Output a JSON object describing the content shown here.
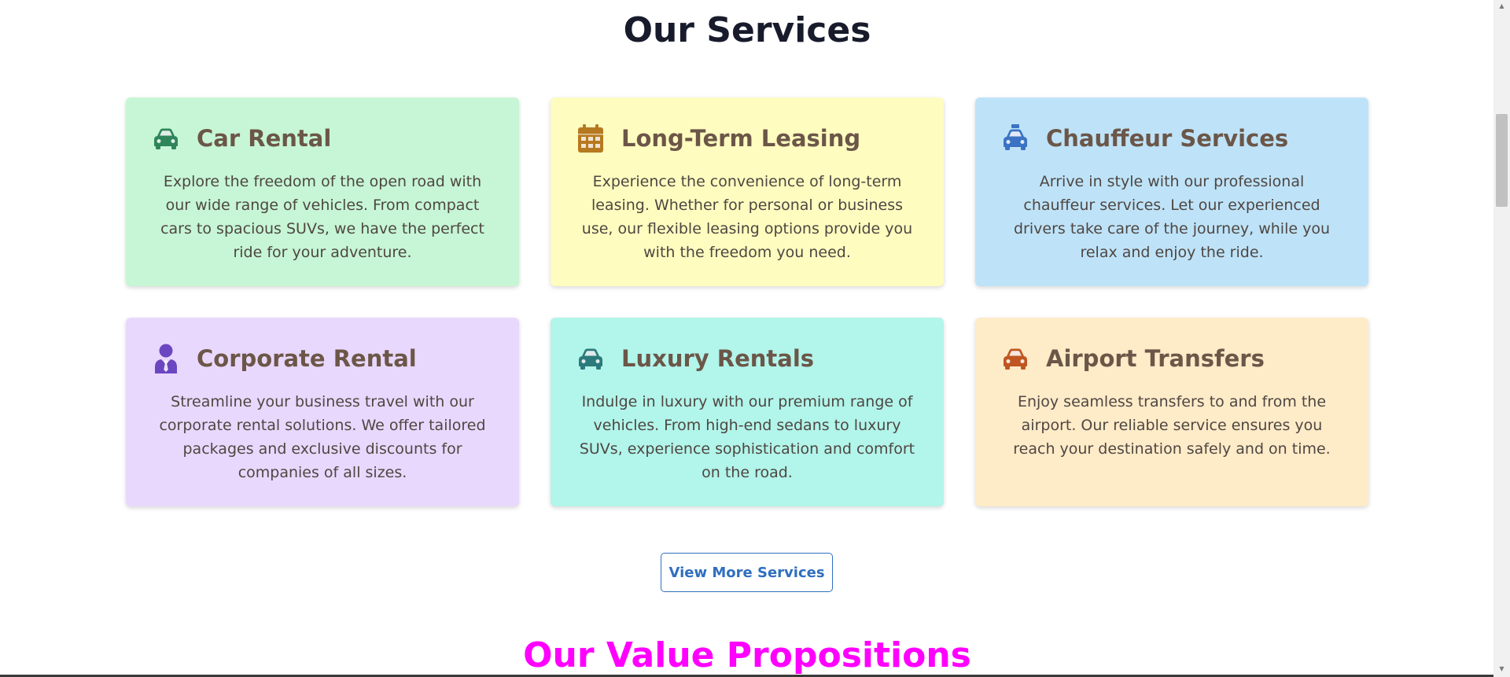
{
  "services": {
    "title": "Our Services",
    "cards": [
      {
        "icon": "car-icon",
        "title": "Car Rental",
        "description": "Explore the freedom of the open road with our wide range of vehicles. From compact cars to spacious SUVs, we have the perfect ride for your adventure.",
        "bg_color": "#c6f6d5",
        "icon_color": "#2f855a"
      },
      {
        "icon": "calendar-icon",
        "title": "Long-Term Leasing",
        "description": "Experience the convenience of long-term leasing. Whether for personal or business use, our flexible leasing options provide you with the freedom you need.",
        "bg_color": "#fefcbf",
        "icon_color": "#b7791f"
      },
      {
        "icon": "taxi-icon",
        "title": "Chauffeur Services",
        "description": "Arrive in style with our professional chauffeur services. Let our experienced drivers take care of the journey, while you relax and enjoy the ride.",
        "bg_color": "#bee3f8",
        "icon_color": "#3b73c4"
      },
      {
        "icon": "user-tie-icon",
        "title": "Corporate Rental",
        "description": "Streamline your business travel with our corporate rental solutions. We offer tailored packages and exclusive discounts for companies of all sizes.",
        "bg_color": "#e9d8fd",
        "icon_color": "#6b46c1"
      },
      {
        "icon": "car-icon",
        "title": "Luxury Rentals",
        "description": "Indulge in luxury with our premium range of vehicles. From high-end sedans to luxury SUVs, experience sophistication and comfort on the road.",
        "bg_color": "#b2f5ea",
        "icon_color": "#2c7a7b"
      },
      {
        "icon": "car-icon",
        "title": "Airport Transfers",
        "description": "Enjoy seamless transfers to and from the airport. Our reliable service ensures you reach your destination safely and on time.",
        "bg_color": "#feebc8",
        "icon_color": "#c05621"
      }
    ],
    "button_label": "View More Services"
  },
  "value_propositions": {
    "title": "Our Value Propositions",
    "title_color": "#ff00ff"
  }
}
